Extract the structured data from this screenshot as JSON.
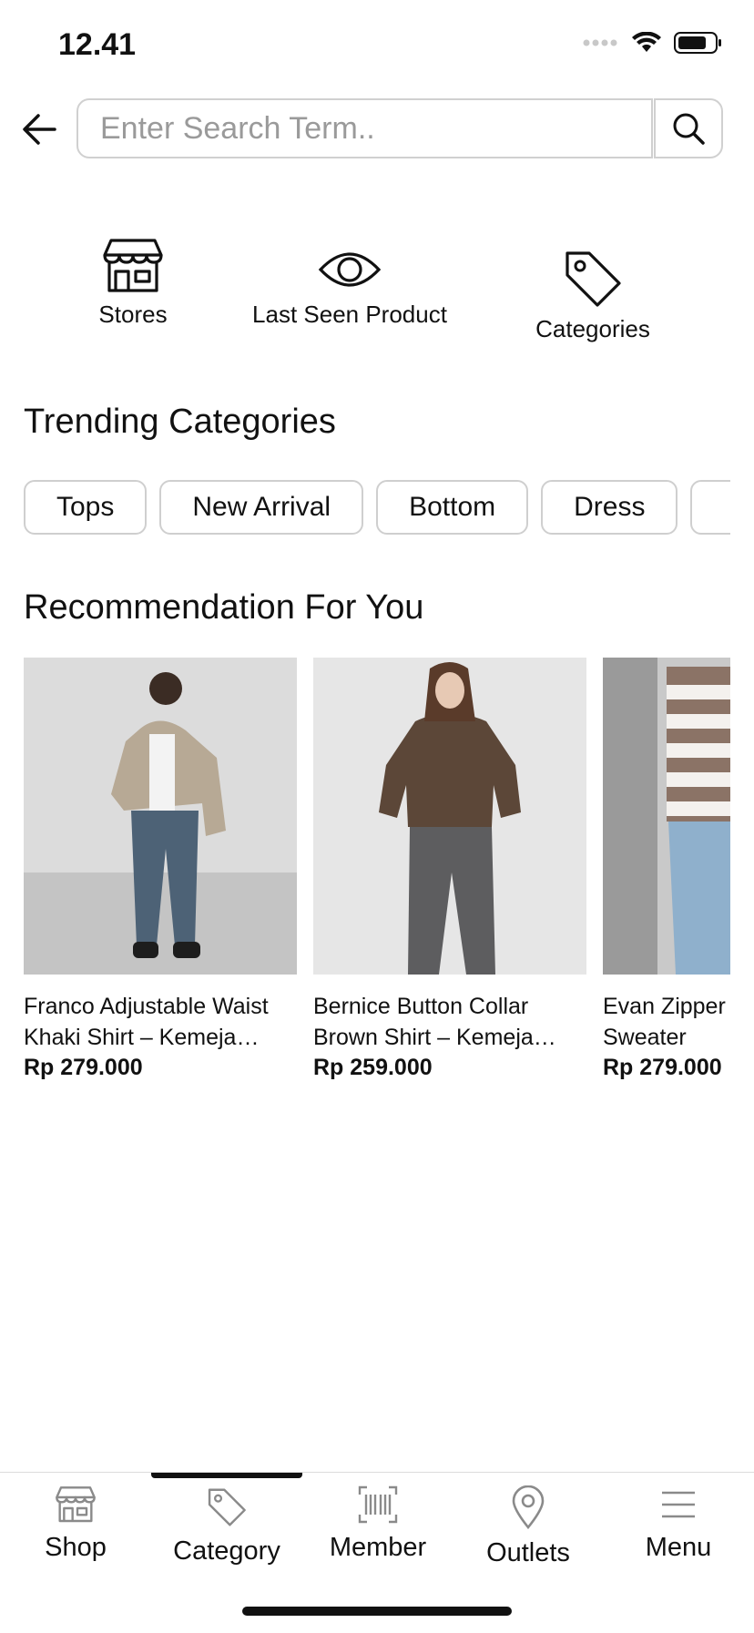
{
  "status": {
    "time": "12.41",
    "icons": [
      "signal-icon",
      "wifi-icon",
      "battery-icon"
    ]
  },
  "search": {
    "placeholder": "Enter Search Term..",
    "value": ""
  },
  "quick_links": [
    {
      "label": "Stores",
      "icon": "store-icon"
    },
    {
      "label": "Last Seen Product",
      "icon": "eye-icon"
    },
    {
      "label": "Categories",
      "icon": "tag-icon"
    }
  ],
  "trending": {
    "title": "Trending Categories",
    "chips": [
      "Tops",
      "New Arrival",
      "Bottom",
      "Dress",
      ""
    ]
  },
  "recommendation": {
    "title": "Recommendation For You",
    "products": [
      {
        "name": "Franco Adjustable Waist Khaki Shirt – Kemeja…",
        "price": "Rp 279.000"
      },
      {
        "name": "Bernice Button Collar Brown Shirt – Kemeja…",
        "price": "Rp 259.000"
      },
      {
        "name": "Evan Zipper Brown Sweater",
        "price": "Rp 279.000"
      }
    ]
  },
  "bottom_nav": {
    "active": "Category",
    "items": [
      {
        "label": "Shop",
        "icon": "shop-icon"
      },
      {
        "label": "Category",
        "icon": "tag-icon"
      },
      {
        "label": "Member",
        "icon": "barcode-icon"
      },
      {
        "label": "Outlets",
        "icon": "location-pin-icon"
      },
      {
        "label": "Menu",
        "icon": "hamburger-menu-icon"
      }
    ]
  }
}
